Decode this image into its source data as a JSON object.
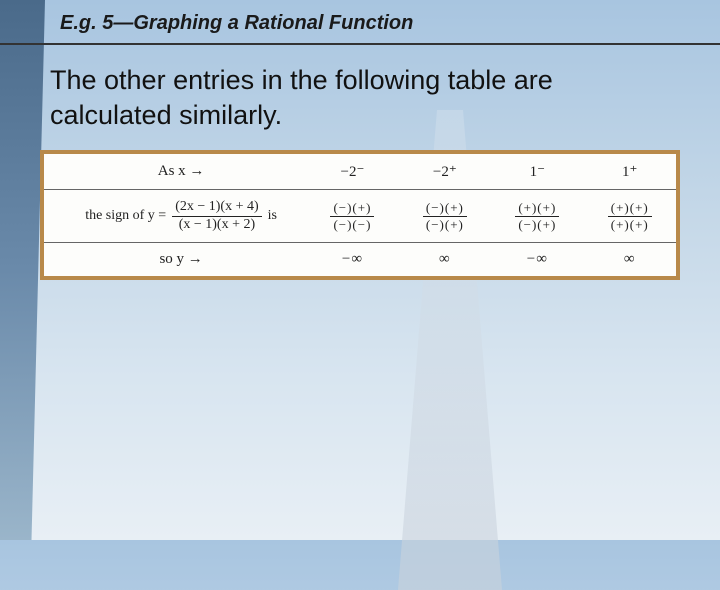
{
  "header": {
    "title": "E.g. 5—Graphing a Rational Function"
  },
  "body": {
    "text": "The other entries in the following table are calculated similarly."
  },
  "table": {
    "row1_label": "As x →",
    "row1_vals": [
      "−2⁻",
      "−2⁺",
      "1⁻",
      "1⁺"
    ],
    "row2_prefix": "the sign of  y =",
    "row2_suffix": "is",
    "row2_formula_num": "(2x − 1)(x + 4)",
    "row2_formula_den": "(x − 1)(x + 2)",
    "row2_signs": [
      {
        "num": "(−)(+)",
        "den": "(−)(−)"
      },
      {
        "num": "(−)(+)",
        "den": "(−)(+)"
      },
      {
        "num": "(+)(+)",
        "den": "(−)(+)"
      },
      {
        "num": "(+)(+)",
        "den": "(+)(+)"
      }
    ],
    "row3_label": "so y →",
    "row3_vals": [
      "−∞",
      "∞",
      "−∞",
      "∞"
    ]
  }
}
